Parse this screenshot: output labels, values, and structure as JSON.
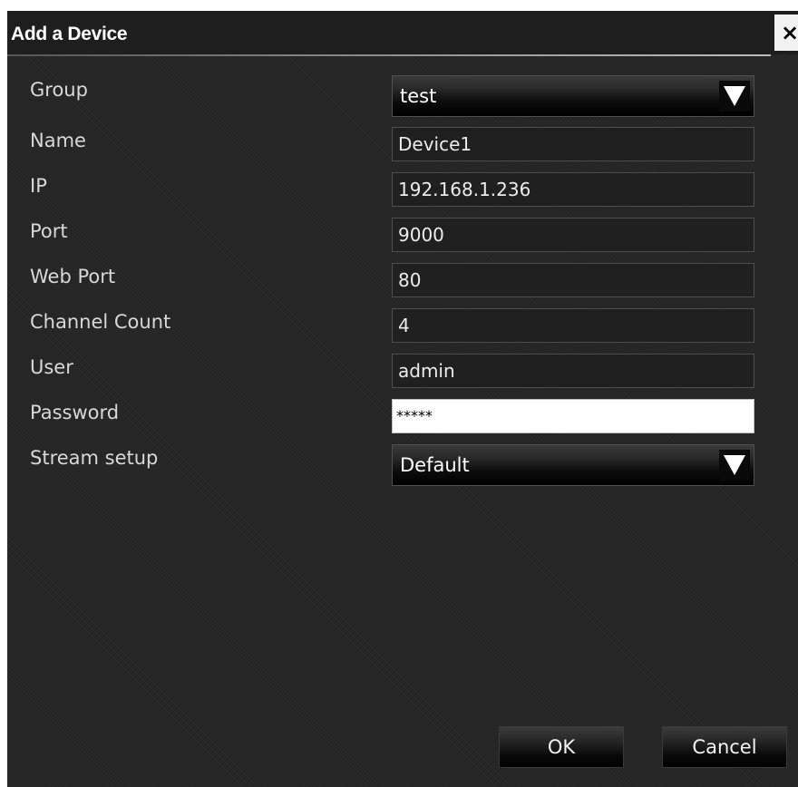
{
  "dialog": {
    "title": "Add a Device",
    "close_glyph": "×"
  },
  "form": {
    "group": {
      "label": "Group",
      "value": "test"
    },
    "name": {
      "label": "Name",
      "value": "Device1"
    },
    "ip": {
      "label": "IP",
      "value": "192.168.1.236"
    },
    "port": {
      "label": "Port",
      "value": "9000"
    },
    "web_port": {
      "label": "Web Port",
      "value": "80"
    },
    "channel_count": {
      "label": "Channel Count",
      "value": "4"
    },
    "user": {
      "label": "User",
      "value": "admin"
    },
    "password": {
      "label": "Password",
      "value": "*****"
    },
    "stream_setup": {
      "label": "Stream setup",
      "value": "Default"
    }
  },
  "buttons": {
    "ok_label": "OK",
    "cancel_label": "Cancel"
  },
  "icons": {
    "close": "close-icon",
    "dropdown": "triangle-down-icon"
  },
  "colors": {
    "background": "#252525",
    "text": "#d8d8d8",
    "field_border": "#4e4e4e",
    "password_field_bg": "#ffffff"
  }
}
